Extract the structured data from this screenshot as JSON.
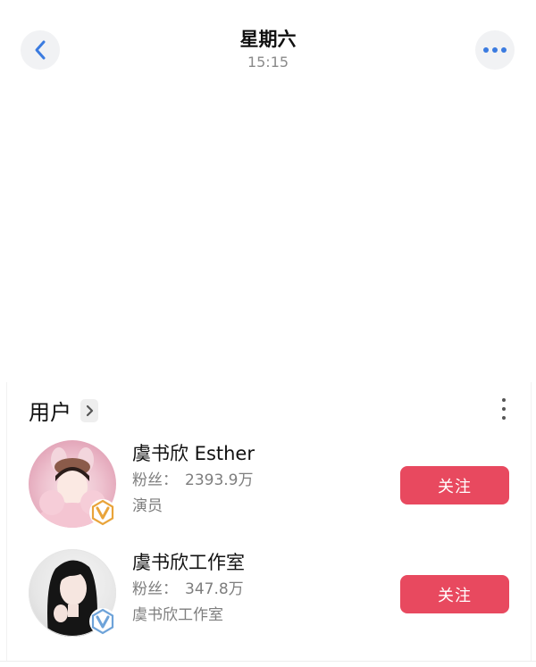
{
  "header": {
    "title": "星期六",
    "subtitle": "15:15"
  },
  "icons": {
    "back": "chevron-left-icon",
    "more": "more-horizontal-icon",
    "section_more": "more-vertical-icon",
    "verified": "verified-v-badge-icon"
  },
  "colors": {
    "accent_blue": "#3b7be0",
    "follow_red": "#e8495f",
    "badge_gold": "#e9a43a",
    "badge_blue": "#6ea3d9"
  },
  "section": {
    "title": "用户"
  },
  "users": [
    {
      "name": "虞书欣 Esther",
      "fans_label": "粉丝：",
      "fans_value": "2393.9万",
      "description": "演员",
      "follow_label": "关注",
      "badge_color": "gold"
    },
    {
      "name": "虞书欣工作室",
      "fans_label": "粉丝：",
      "fans_value": "347.8万",
      "description": "虞书欣工作室",
      "follow_label": "关注",
      "badge_color": "blue"
    }
  ]
}
